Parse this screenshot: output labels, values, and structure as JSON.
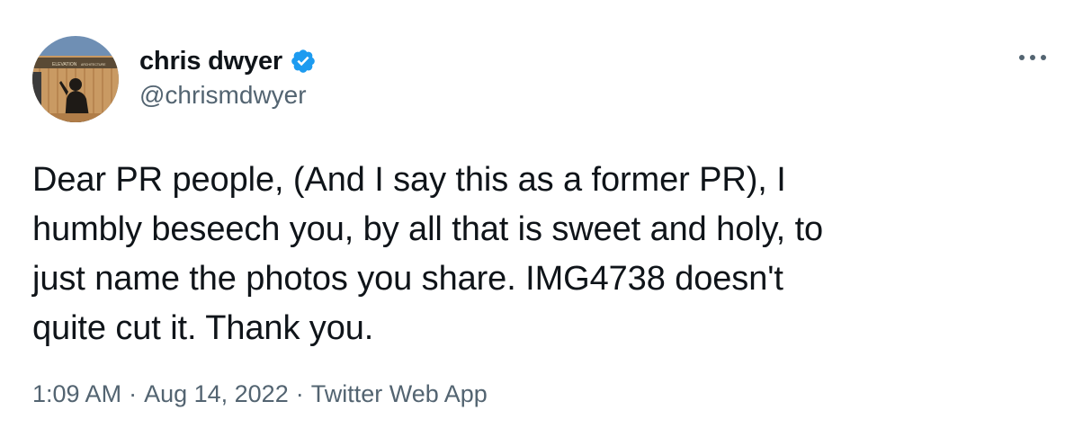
{
  "author": {
    "display_name": "chris dwyer",
    "handle": "@chrismdwyer",
    "verified": true,
    "avatar_sign_text": "ELEVATION",
    "avatar_sign_subtext": "ARCHITECTURE"
  },
  "tweet": {
    "text": "Dear PR people, (And I say this as a former PR), I\nhumbly beseech you, by all that is sweet and holy, to\njust name the photos you share. IMG4738 doesn't\nquite cut it. Thank you."
  },
  "meta": {
    "time": "1:09 AM",
    "separator": "·",
    "date": "Aug 14, 2022",
    "source": "Twitter Web App"
  },
  "icons": {
    "verified": "verified-badge-icon",
    "more": "more-horizontal-icon"
  },
  "colors": {
    "text_primary": "#0f1419",
    "text_secondary": "#536471",
    "verified_blue": "#1d9bf0"
  }
}
